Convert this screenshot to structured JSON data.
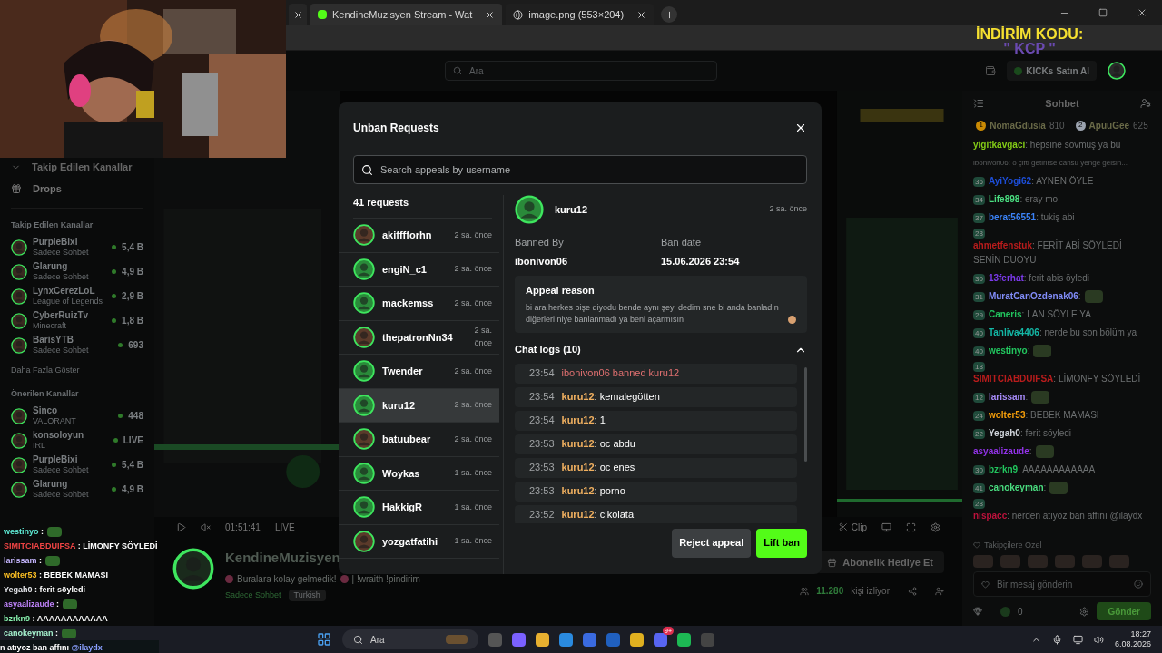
{
  "browser": {
    "tabs": [
      {
        "kind": "cut"
      },
      {
        "kind": "full",
        "title": "KendineMuzisyen Stream - Wat",
        "selected": true
      },
      {
        "kind": "full",
        "title": "image.png (553×204)",
        "selected": false
      }
    ]
  },
  "overlay": {
    "promo_title": "İNDİRİM KODU:",
    "promo_code": "\" KCP \"",
    "chat": [
      {
        "user": "westinyo",
        "color": "#5eead4",
        "text": ":",
        "emote": true
      },
      {
        "user": "SIMITCIABDUIFSA",
        "color": "#ef4444",
        "text": ": LİMONFY SÖYLEDİ",
        "emote": false
      },
      {
        "user": "larissam",
        "color": "#c4b5fd",
        "text": ":",
        "emote": true
      },
      {
        "user": "wolter53",
        "color": "#fbbf24",
        "text": ": BEBEK MAMASI",
        "emote": false
      },
      {
        "user": "Yegah0",
        "color": "#e5e7eb",
        "text": ": ferit söyledi",
        "emote": false
      },
      {
        "user": "asyaalizaude",
        "color": "#c084fc",
        "text": ":",
        "emote": true
      },
      {
        "user": "bzrkn9",
        "color": "#86efac",
        "text": ": AAAAAAAAAAAA",
        "emote": false
      },
      {
        "user": "canokeyman",
        "color": "#a7f3d0",
        "text": ":",
        "emote": true
      }
    ],
    "last_line": {
      "text": "n atıyoz ban affını",
      "mention": "@ilaydx"
    }
  },
  "header": {
    "search_placeholder": "Ara",
    "kicks_button": "KICKs Satın Al"
  },
  "sidebar": {
    "collapsed_heading": "Takip Edilen Kanallar",
    "drops": "Drops",
    "followed_heading": "Takip Edilen Kanallar",
    "followed": [
      {
        "name": "PurpleBixi",
        "sub": "Sadece Sohbet",
        "viewers": "5,4 B"
      },
      {
        "name": "Glarung",
        "sub": "Sadece Sohbet",
        "viewers": "4,9 B"
      },
      {
        "name": "LynxCerezLoL",
        "sub": "League of Legends",
        "viewers": "2,9 B"
      },
      {
        "name": "CyberRuizTv",
        "sub": "Minecraft",
        "viewers": "1,8 B"
      },
      {
        "name": "BarisYTB",
        "sub": "Sadece Sohbet",
        "viewers": "693"
      }
    ],
    "show_more": "Daha Fazla Göster",
    "suggested_heading": "Önerilen Kanallar",
    "suggested": [
      {
        "name": "Sinco",
        "sub": "VALORANT",
        "viewers": "448"
      },
      {
        "name": "konsoloyun",
        "sub": "IRL",
        "viewers": "LIVE"
      },
      {
        "name": "PurpleBixi",
        "sub": "Sadece Sohbet",
        "viewers": "5,4 B"
      },
      {
        "name": "Glarung",
        "sub": "Sadece Sohbet",
        "viewers": "4,9 B"
      }
    ]
  },
  "player": {
    "time": "01:51:41",
    "live": "LIVE",
    "clip": "Clip"
  },
  "channel": {
    "name": "KendineMuzisyen",
    "bio_1": "Buralara kolay gelmedik!",
    "bio_2": "| !wraith !pindirim",
    "tags": [
      "Sadece Sohbet",
      "Turkish"
    ],
    "gift_button": "Abonelik Hediye Et",
    "viewers": "11.280",
    "viewers_label": "kişi izliyor"
  },
  "chat": {
    "title": "Sohbet",
    "leaders": [
      {
        "rank": "1",
        "name": "NomaGdusia",
        "score": "810",
        "color": "#ca8a04"
      },
      {
        "rank": "2",
        "name": "ApuuGee",
        "score": "625",
        "color": "#9ca3af"
      }
    ],
    "messages": [
      {
        "kind": "text",
        "user": "yigitkavgaci",
        "color": "#84cc16",
        "text": ": hepsine sövmüş ya bu"
      },
      {
        "kind": "reply",
        "text": "ibonivon06: o çifti getirirse cansu yenge gelsin..."
      },
      {
        "kind": "text",
        "badge": "36",
        "user": "AyiYogi62",
        "color": "#1d4ed8",
        "text": ": AYNEN ÖYLE"
      },
      {
        "kind": "text",
        "badge": "34",
        "user": "Life898",
        "color": "#4ade80",
        "text": ": eray mo"
      },
      {
        "kind": "text",
        "badge": "37",
        "user": "berat56551",
        "color": "#3b82f6",
        "text": ": tukiş abi"
      },
      {
        "kind": "text",
        "badge": "28",
        "user": "ahmetfenstuk",
        "color": "#b91c1c",
        "text": ": FERİT ABİ SÖYLEDİ SENİN DUOYU"
      },
      {
        "kind": "text",
        "badge": "30",
        "user": "13ferhat",
        "color": "#7c3aed",
        "text": ": ferit abis öyledi"
      },
      {
        "kind": "emote",
        "badge": "31",
        "user": "MuratCanOzdenak06",
        "color": "#818cf8",
        "text": ":"
      },
      {
        "kind": "text",
        "badge": "29",
        "user": "Caneris",
        "color": "#22c55e",
        "text": ": LAN SÖYLE YA"
      },
      {
        "kind": "text",
        "badge": "40",
        "user": "Tanliva4406",
        "color": "#14b8a6",
        "text": ": nerde bu son bölüm ya"
      },
      {
        "kind": "emote",
        "badge": "40",
        "user": "westinyo",
        "color": "#22c55e",
        "text": ":"
      },
      {
        "kind": "text",
        "badge": "18",
        "user": "SIMITCIABDUIFSA",
        "color": "#b91c1c",
        "text": ": LİMONFY SÖYLEDİ"
      },
      {
        "kind": "emote",
        "badge": "12",
        "user": "larissam",
        "color": "#a78bfa",
        "text": ":"
      },
      {
        "kind": "text",
        "badge": "24",
        "user": "wolter53",
        "color": "#f59e0b",
        "text": ": BEBEK MAMASI"
      },
      {
        "kind": "text",
        "badge": "22",
        "user": "Yegah0",
        "color": "#d1d5db",
        "text": ": ferit söyledi"
      },
      {
        "kind": "emote",
        "user": "asyaalizaude",
        "color": "#9333ea",
        "text": ":"
      },
      {
        "kind": "text",
        "badge": "30",
        "user": "bzrkn9",
        "color": "#22c55e",
        "text": ": AAAAAAAAAAAA"
      },
      {
        "kind": "emote",
        "badge": "41",
        "user": "canokeyman",
        "color": "#4ade80",
        "text": ":"
      },
      {
        "kind": "text",
        "badge": "28",
        "user": "nispacc",
        "color": "#be123c",
        "text": ": nerden atıyoz ban affını @ilaydx"
      }
    ],
    "followers_label": "Takipçilere Özel",
    "input_placeholder": "Bir mesaj gönderin",
    "kicks_count": "0",
    "send_button": "Gönder"
  },
  "modal": {
    "title": "Unban Requests",
    "search_placeholder": "Search appeals by username",
    "count": "41 requests",
    "requests": [
      {
        "name": "akifffforhn",
        "time": "2 sa. önce",
        "selected": false
      },
      {
        "name": "engiN_c1",
        "time": "2 sa. önce",
        "selected": false
      },
      {
        "name": "mackemss",
        "time": "2 sa. önce",
        "selected": false
      },
      {
        "name": "thepatronNn34",
        "time": "2 sa. önce",
        "selected": false
      },
      {
        "name": "Twender",
        "time": "2 sa. önce",
        "selected": false
      },
      {
        "name": "kuru12",
        "time": "2 sa. önce",
        "selected": true
      },
      {
        "name": "batuubear",
        "time": "2 sa. önce",
        "selected": false
      },
      {
        "name": "Woykas",
        "time": "1 sa. önce",
        "selected": false
      },
      {
        "name": "HakkigR",
        "time": "1 sa. önce",
        "selected": false
      },
      {
        "name": "yozgatfatihi",
        "time": "1 sa. önce",
        "selected": false
      }
    ],
    "detail": {
      "user": "kuru12",
      "time": "2 sa. önce",
      "banned_by_label": "Banned By",
      "banned_by": "ibonivon06",
      "ban_date_label": "Ban date",
      "ban_date": "15.06.2026 23:54",
      "reason_title": "Appeal reason",
      "reason": "bi ara herkes bişe diyodu bende aynı şeyi dedim sne bi anda banladın diğerleri niye banlanmadı ya beni açarmısın",
      "logs_title": "Chat logs (10)",
      "logs_expanded": true,
      "logs": [
        {
          "kind": "ban",
          "time": "23:54",
          "text": "ibonivon06 banned kuru12"
        },
        {
          "kind": "message",
          "time": "23:54",
          "user": "kuru12",
          "text": ": kemalegötten"
        },
        {
          "kind": "message",
          "time": "23:54",
          "user": "kuru12",
          "text": ": 1"
        },
        {
          "kind": "message",
          "time": "23:53",
          "user": "kuru12",
          "text": ": oc abdu"
        },
        {
          "kind": "message",
          "time": "23:53",
          "user": "kuru12",
          "text": ": oc enes"
        },
        {
          "kind": "message",
          "time": "23:53",
          "user": "kuru12",
          "text": ": porno"
        },
        {
          "kind": "message",
          "time": "23:52",
          "user": "kuru12",
          "text": ": cikolata"
        }
      ]
    },
    "reject_button": "Reject appeal",
    "lift_button": "Lift ban"
  },
  "taskbar": {
    "search_placeholder": "Ara",
    "discord_badge": "9+",
    "time": "18:27",
    "date": "6.08.2026"
  }
}
